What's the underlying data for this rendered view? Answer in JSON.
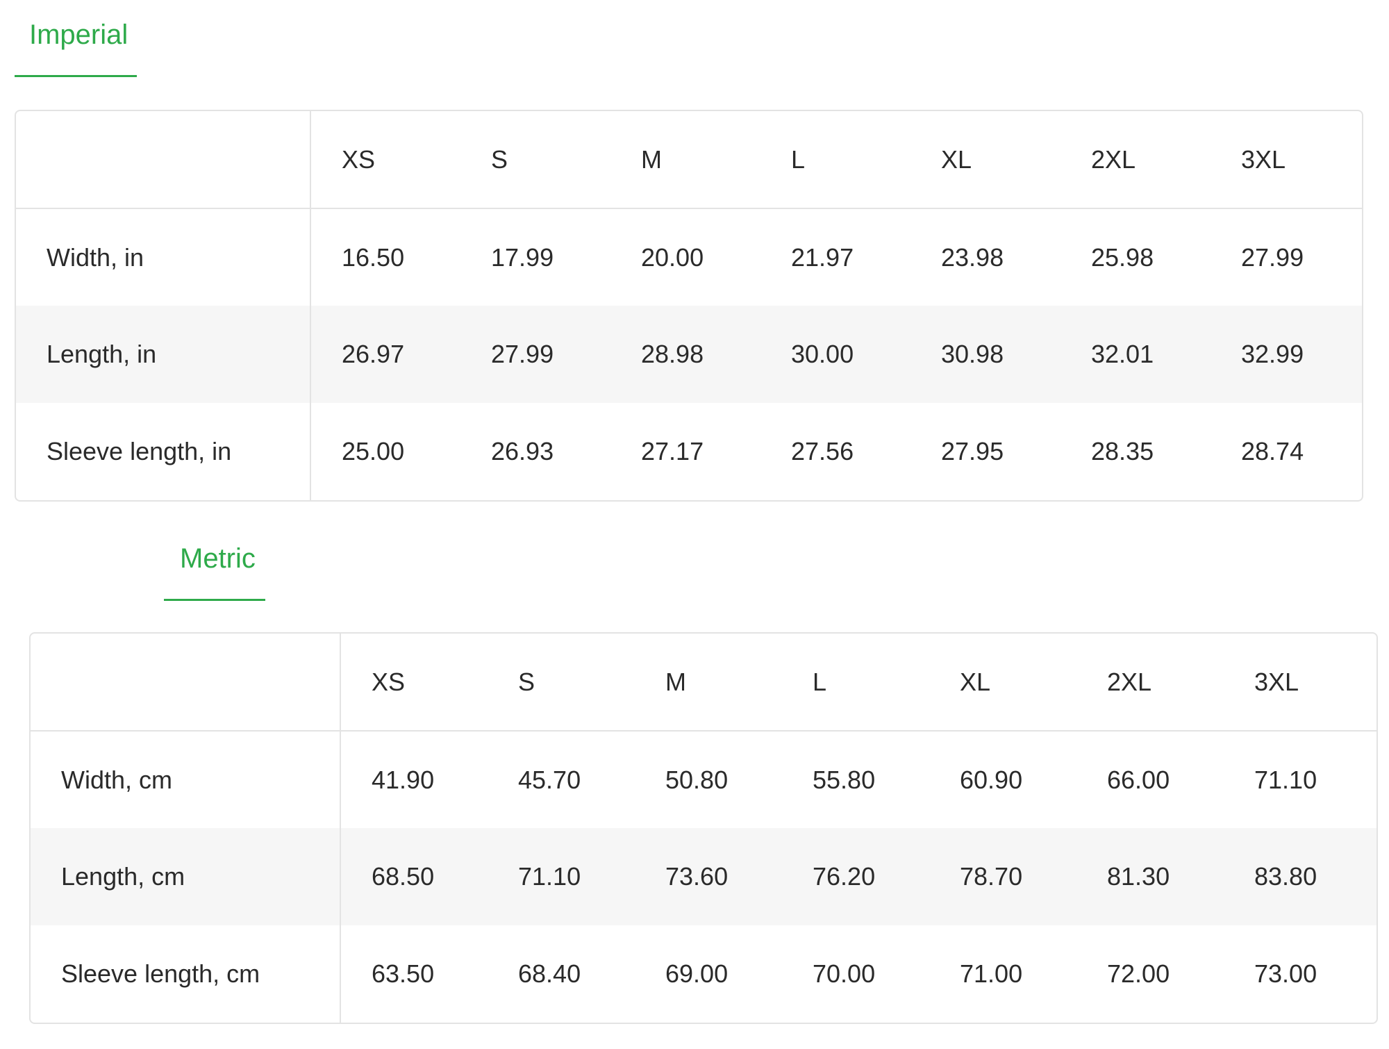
{
  "imperial": {
    "tab_label": "Imperial",
    "sizes": [
      "XS",
      "S",
      "M",
      "L",
      "XL",
      "2XL",
      "3XL"
    ],
    "rows": [
      {
        "label": "Width, in",
        "values": [
          "16.50",
          "17.99",
          "20.00",
          "21.97",
          "23.98",
          "25.98",
          "27.99"
        ]
      },
      {
        "label": "Length, in",
        "values": [
          "26.97",
          "27.99",
          "28.98",
          "30.00",
          "30.98",
          "32.01",
          "32.99"
        ]
      },
      {
        "label": "Sleeve length, in",
        "values": [
          "25.00",
          "26.93",
          "27.17",
          "27.56",
          "27.95",
          "28.35",
          "28.74"
        ]
      }
    ]
  },
  "metric": {
    "tab_label": "Metric",
    "sizes": [
      "XS",
      "S",
      "M",
      "L",
      "XL",
      "2XL",
      "3XL"
    ],
    "rows": [
      {
        "label": "Width, cm",
        "values": [
          "41.90",
          "45.70",
          "50.80",
          "55.80",
          "60.90",
          "66.00",
          "71.10"
        ]
      },
      {
        "label": "Length, cm",
        "values": [
          "68.50",
          "71.10",
          "73.60",
          "76.20",
          "78.70",
          "81.30",
          "83.80"
        ]
      },
      {
        "label": "Sleeve length, cm",
        "values": [
          "63.50",
          "68.40",
          "69.00",
          "70.00",
          "71.00",
          "72.00",
          "73.00"
        ]
      }
    ]
  },
  "colors": {
    "accent": "#2eaa4a",
    "border": "#e3e3e3",
    "row_shade": "#f6f6f6",
    "text": "#2a2a2a"
  }
}
